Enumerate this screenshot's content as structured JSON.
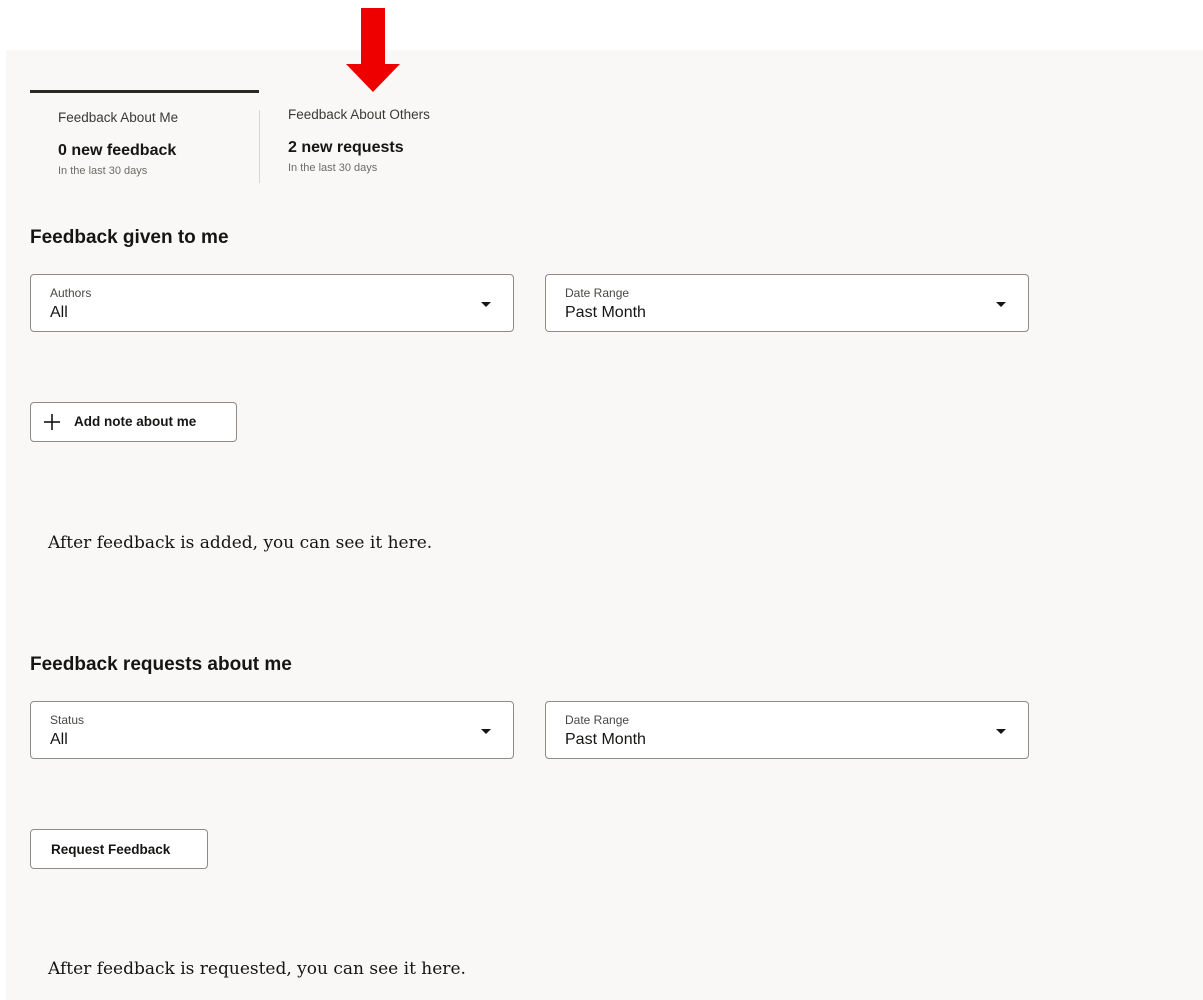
{
  "colors": {
    "accent_arrow": "#ee0000",
    "panel_bg": "#f9f8f6",
    "text": "#161513"
  },
  "tabs": [
    {
      "title": "Feedback About Me",
      "count": "0 new feedback",
      "subtitle": "In the last 30 days",
      "active": true
    },
    {
      "title": "Feedback About Others",
      "count": "2 new requests",
      "subtitle": "In the last 30 days",
      "active": false
    }
  ],
  "given": {
    "heading": "Feedback given to me",
    "authors": {
      "label": "Authors",
      "value": "All"
    },
    "date_range": {
      "label": "Date Range",
      "value": "Past Month"
    },
    "add_button": {
      "label": "Add note about me",
      "icon": "plus-icon"
    },
    "empty_message": "After feedback is added, you can see it here."
  },
  "requests": {
    "heading": "Feedback requests about me",
    "status": {
      "label": "Status",
      "value": "All"
    },
    "date_range": {
      "label": "Date Range",
      "value": "Past Month"
    },
    "request_button": {
      "label": "Request Feedback"
    },
    "empty_message": "After feedback is requested, you can see it here."
  }
}
